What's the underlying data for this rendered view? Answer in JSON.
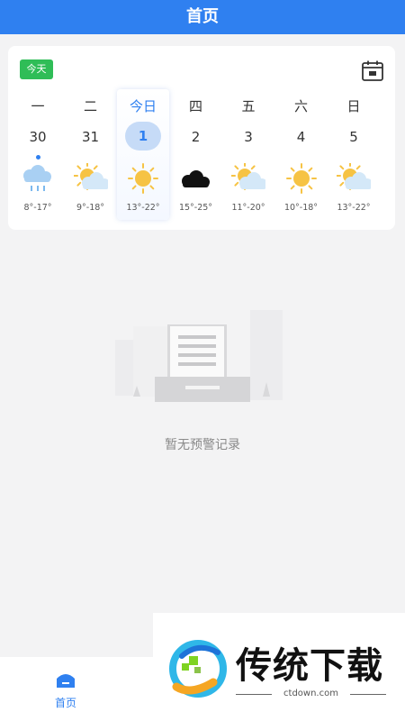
{
  "header": {
    "title": "首页"
  },
  "calendar": {
    "today_button": "今天",
    "calendar_icon": "calendar-icon",
    "days": [
      {
        "weekday": "一",
        "date": "30",
        "weather": "light-rain",
        "temp": "8°-17°",
        "has_dot": true
      },
      {
        "weekday": "二",
        "date": "31",
        "weather": "partly-cloudy",
        "temp": "9°-18°"
      },
      {
        "weekday": "今日",
        "date": "1",
        "weather": "sunny",
        "temp": "13°-22°",
        "selected": true
      },
      {
        "weekday": "四",
        "date": "2",
        "weather": "overcast",
        "temp": "15°-25°"
      },
      {
        "weekday": "五",
        "date": "3",
        "weather": "partly-cloudy",
        "temp": "11°-20°"
      },
      {
        "weekday": "六",
        "date": "4",
        "weather": "sunny",
        "temp": "10°-18°"
      },
      {
        "weekday": "日",
        "date": "5",
        "weather": "partly-cloudy",
        "temp": "13°-22°"
      }
    ]
  },
  "empty_state": {
    "message": "暂无预警记录"
  },
  "tabbar": {
    "home_label": "首页"
  },
  "watermark": {
    "brand": "传统下载",
    "url": "ctdown.com"
  },
  "colors": {
    "primary": "#2f80f0",
    "today_green": "#2fbd57",
    "sun": "#f6c344"
  }
}
